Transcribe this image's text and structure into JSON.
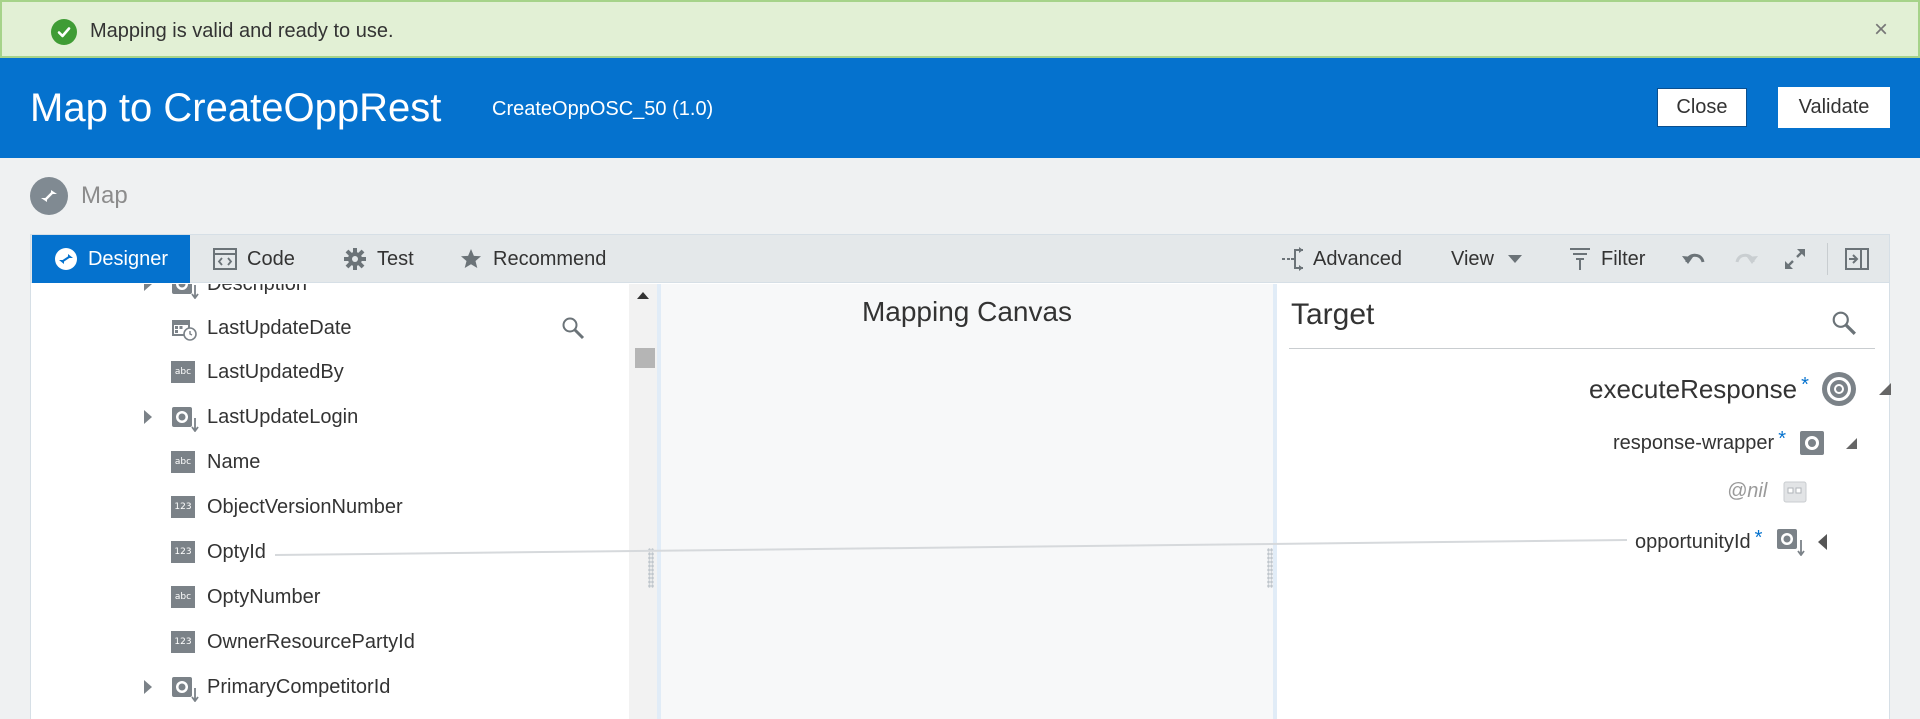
{
  "banner": {
    "message": "Mapping is valid and ready to use.",
    "close_glyph": "×",
    "status_color": "#3f9c35"
  },
  "header": {
    "title": "Map to CreateOppRest",
    "subtitle": "CreateOppOSC_50 (1.0)",
    "close_label": "Close",
    "validate_label": "Validate",
    "bg_color": "#0572ce"
  },
  "map_section": {
    "label": "Map"
  },
  "toolbar": {
    "tabs": [
      {
        "label": "Designer",
        "icon": "designer-icon",
        "active": true
      },
      {
        "label": "Code",
        "icon": "code-icon"
      },
      {
        "label": "Test",
        "icon": "gear-icon"
      },
      {
        "label": "Recommend",
        "icon": "star-icon"
      }
    ],
    "advanced_label": "Advanced",
    "view_label": "View",
    "filter_label": "Filter"
  },
  "source": {
    "items": [
      {
        "label": "Description",
        "type": "complex",
        "expandable": true
      },
      {
        "label": "LastUpdateDate",
        "type": "date"
      },
      {
        "label": "LastUpdatedBy",
        "type": "abc"
      },
      {
        "label": "LastUpdateLogin",
        "type": "complex",
        "expandable": true
      },
      {
        "label": "Name",
        "type": "abc"
      },
      {
        "label": "ObjectVersionNumber",
        "type": "123"
      },
      {
        "label": "OptyId",
        "type": "123"
      },
      {
        "label": "OptyNumber",
        "type": "abc"
      },
      {
        "label": "OwnerResourcePartyId",
        "type": "123"
      },
      {
        "label": "PrimaryCompetitorId",
        "type": "complex",
        "expandable": true
      }
    ],
    "abc_text": "abc",
    "num_text": "123"
  },
  "canvas": {
    "title": "Mapping Canvas"
  },
  "target": {
    "title": "Target",
    "nodes": {
      "execute_response": "executeResponse",
      "response_wrapper": "response-wrapper",
      "nil": "@nil",
      "opportunity_id": "opportunityId"
    },
    "required_mark": "*"
  }
}
